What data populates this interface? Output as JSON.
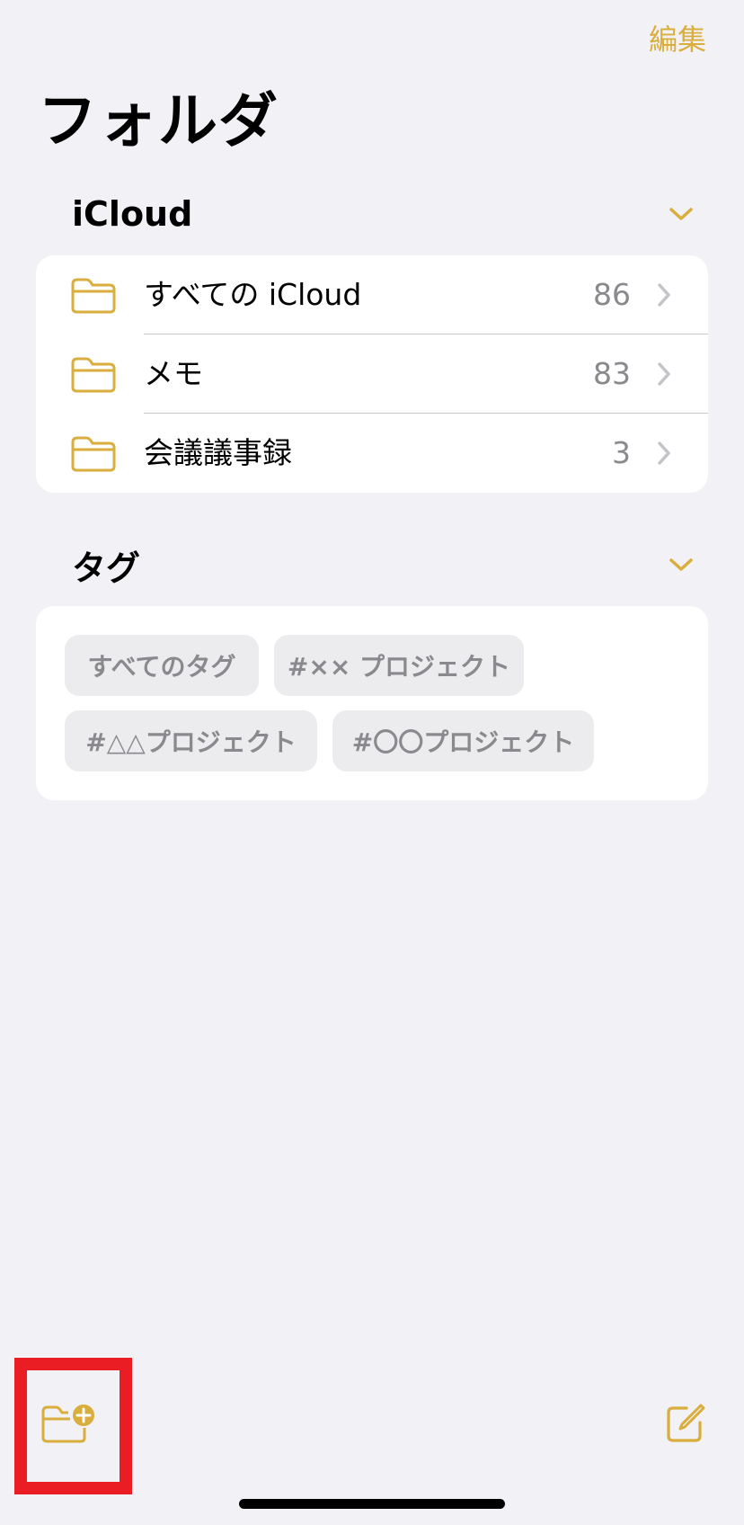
{
  "header": {
    "edit_label": "編集",
    "title": "フォルダ"
  },
  "icloud": {
    "section_label": "iCloud",
    "folders": [
      {
        "name": "すべての iCloud",
        "count": "86"
      },
      {
        "name": "メモ",
        "count": "83"
      },
      {
        "name": "会議議事録",
        "count": "3"
      }
    ]
  },
  "tags": {
    "section_label": "タグ",
    "items": [
      "すべてのタグ",
      "#×× プロジェクト",
      "#△△プロジェクト",
      "#〇〇プロジェクト"
    ]
  },
  "toolbar": {
    "new_folder_icon": "folder-plus-icon",
    "compose_icon": "compose-icon"
  },
  "colors": {
    "accent": "#d9ae3c",
    "background": "#f1f1f6",
    "highlight": "#ea1c24"
  }
}
